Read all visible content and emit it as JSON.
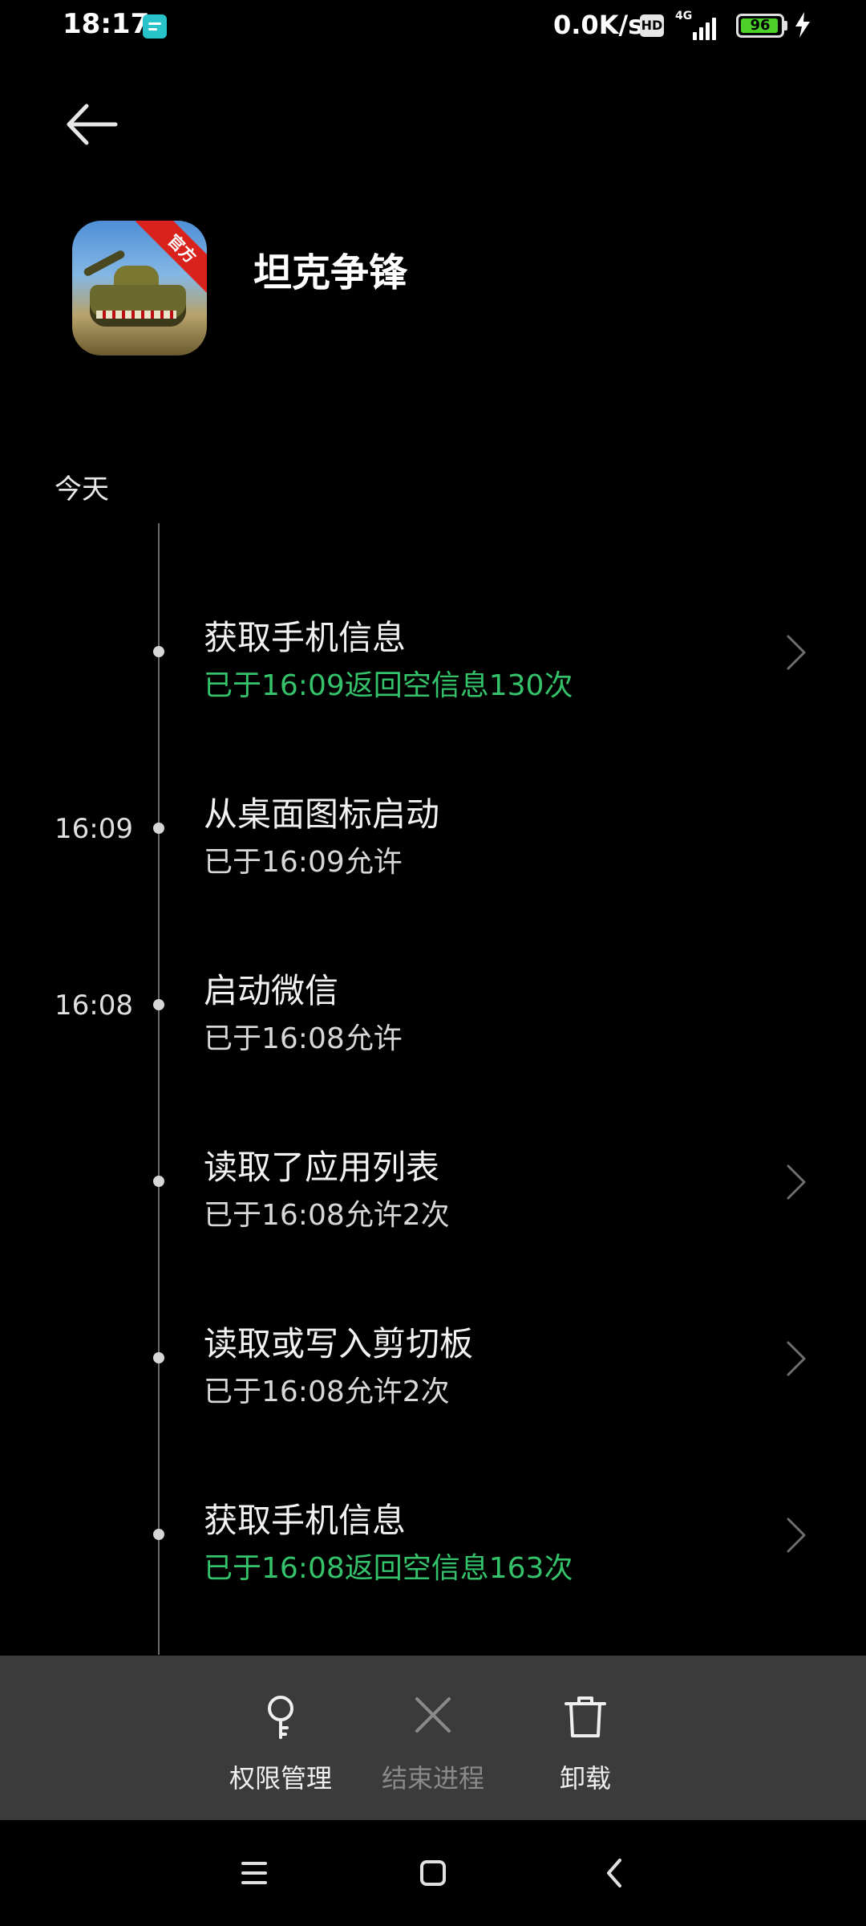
{
  "status_bar": {
    "time": "18:17",
    "net_speed": "0.0K/s",
    "hd_label": "HD",
    "network_type": "4G",
    "battery_level": "96",
    "battery_fraction": 0.96,
    "icons": [
      "notification-icon",
      "hd-icon",
      "signal-icon",
      "battery-icon",
      "charging-bolt-icon"
    ]
  },
  "header": {
    "back_icon": "back-arrow-icon",
    "app_name": "坦克争锋",
    "app_icon_badge": "官方"
  },
  "timeline": {
    "section_label": "今天",
    "entries": [
      {
        "time": "",
        "title": "获取手机信息",
        "subtitle": "已于16:09返回空信息130次",
        "subtitle_color": "#34c36b",
        "has_chevron": true
      },
      {
        "time": "16:09",
        "title": "从桌面图标启动",
        "subtitle": "已于16:09允许",
        "has_chevron": false
      },
      {
        "time": "16:08",
        "title": "启动微信",
        "subtitle": "已于16:08允许",
        "has_chevron": false
      },
      {
        "time": "",
        "title": "读取了应用列表",
        "subtitle": "已于16:08允许2次",
        "has_chevron": true
      },
      {
        "time": "",
        "title": "读取或写入剪切板",
        "subtitle": "已于16:08允许2次",
        "has_chevron": true
      },
      {
        "time": "",
        "title": "获取手机信息",
        "subtitle": "已于16:08返回空信息163次",
        "subtitle_color": "#34c36b",
        "has_chevron": true
      }
    ]
  },
  "action_bar": {
    "permissions_label": "权限管理",
    "end_process_label": "结束进程",
    "uninstall_label": "卸载"
  },
  "nav_bar": {
    "icons": [
      "menu-icon",
      "home-icon",
      "back-icon"
    ]
  },
  "colors": {
    "background": "#000000",
    "green_text": "#34c36b",
    "action_bar_bg": "#3b3b3b",
    "battery_fill": "#4cd22a"
  }
}
